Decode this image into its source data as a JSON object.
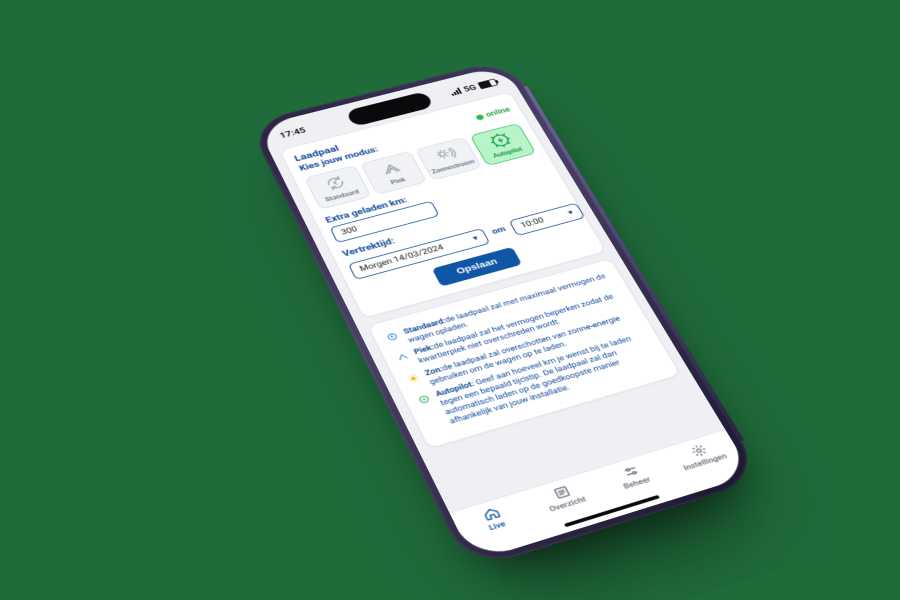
{
  "status_bar": {
    "time": "17:45",
    "network": "5G"
  },
  "card": {
    "title": "Laadpaal",
    "subtitle": "Kies jouw modus:",
    "status_label": "online"
  },
  "modes": [
    {
      "key": "standaard",
      "label": "Standaard",
      "icon": "euro-refresh",
      "selected": false
    },
    {
      "key": "piek",
      "label": "Piek",
      "icon": "peak",
      "selected": false
    },
    {
      "key": "zonnestroom",
      "label": "Zonnestroom",
      "icon": "sun-power",
      "selected": false
    },
    {
      "key": "autopilot",
      "label": "Autopilot",
      "icon": "bolt-circle",
      "selected": true
    }
  ],
  "fields": {
    "km_label": "Extra geladen km:",
    "km_value": "300",
    "depart_label": "Vertrektijd:",
    "date_value": "Morgen 14/03/2024",
    "separator": "om",
    "time_value": "10:00"
  },
  "save_label": "Opslaan",
  "glossary": {
    "standaard": {
      "name": "Standaard:",
      "text": "de laadpaal zal met maximaal vermogen de wagen opladen."
    },
    "piek": {
      "name": "Piek:",
      "text": "de laadpaal zal het vermogen beperken zodat de kwartierpiek niet overschreden wordt."
    },
    "zon": {
      "name": "Zon:",
      "text": "de laadpaal zal overschotten van zonne-energie gebruiken om de wagen op te laden."
    },
    "autopilot": {
      "name": "Autopilot:",
      "text": "Geef aan hoeveel km je wenst bij te laden tegen een bepaald tijdstip. De laadpaal zal dan automatisch laden op de goedkoopste manier afhankelijk van jouw installatie."
    }
  },
  "tabs": [
    {
      "key": "live",
      "label": "Live",
      "icon": "home",
      "active": true
    },
    {
      "key": "overzicht",
      "label": "Overzicht",
      "icon": "list",
      "active": false
    },
    {
      "key": "beheer",
      "label": "Beheer",
      "icon": "sliders",
      "active": false
    },
    {
      "key": "instellingen",
      "label": "Instellingen",
      "icon": "gear",
      "active": false
    }
  ],
  "colors": {
    "primary": "#0f57a6",
    "accent_green": "#23c048"
  }
}
